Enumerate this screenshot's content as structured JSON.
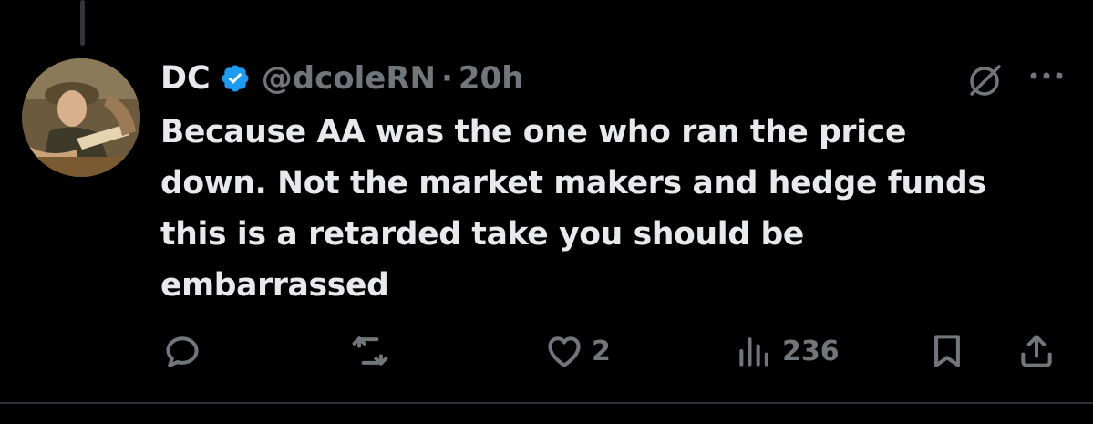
{
  "tweet": {
    "display_name": "DC",
    "handle": "@dcoleRN",
    "separator": "·",
    "time": "20h",
    "text": "Because AA was the one who ran the price down. Not the market makers and hedge funds this is a retarded take you should be embarrassed",
    "verified": true
  },
  "actions": {
    "reply_count": "",
    "retweet_count": "",
    "like_count": "2",
    "views_count": "236"
  },
  "icons": {
    "avatar": "avatar-painting",
    "verified": "verified-badge-icon",
    "grok": "grok-icon",
    "more": "more-icon",
    "reply": "reply-icon",
    "retweet": "retweet-icon",
    "like": "heart-icon",
    "views": "views-icon",
    "bookmark": "bookmark-icon",
    "share": "share-icon"
  },
  "colors": {
    "background": "#000000",
    "text_primary": "#e7e9ea",
    "text_secondary": "#71767b",
    "verified": "#1d9bf0"
  }
}
